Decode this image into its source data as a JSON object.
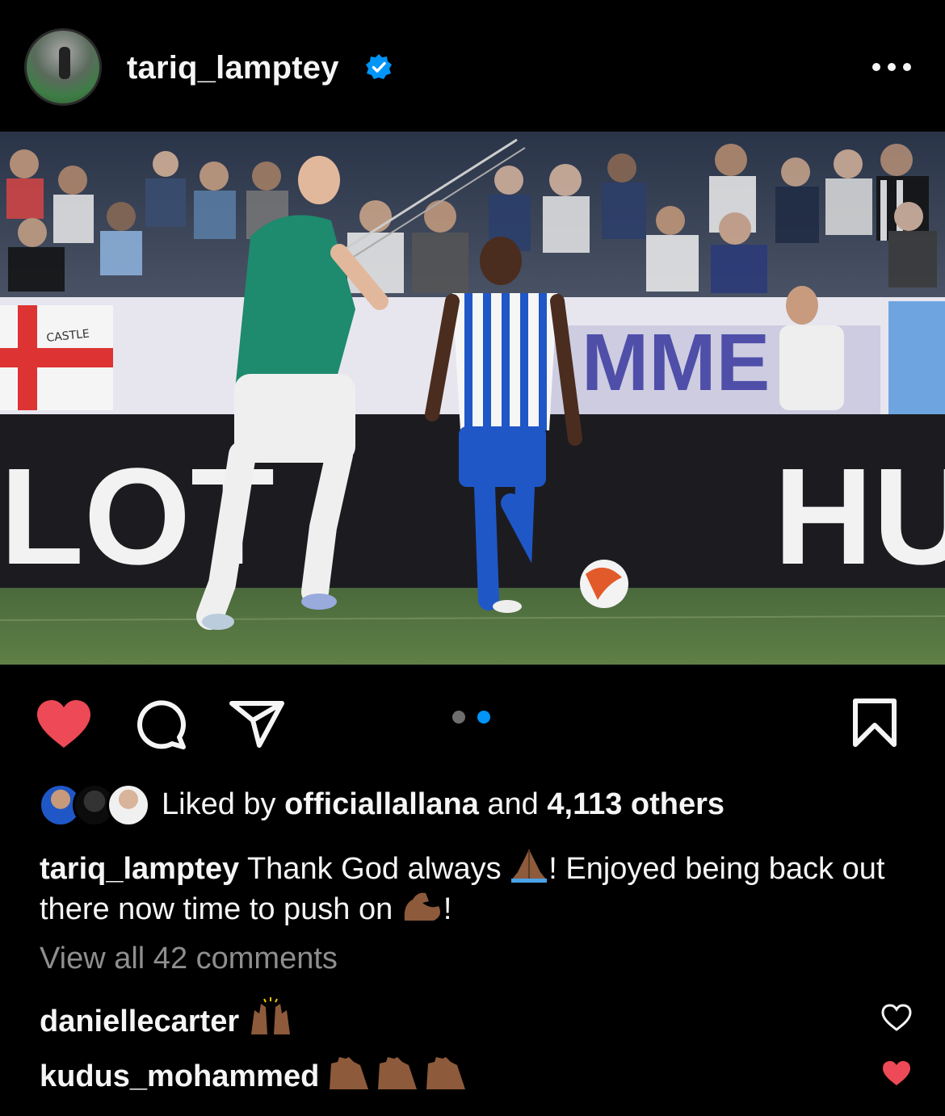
{
  "post": {
    "username": "tariq_lamptey",
    "verified_icon": "verified-badge-icon",
    "more_icon": "more-options-icon"
  },
  "actions": {
    "like_icon": "heart-filled-icon",
    "comment_icon": "comment-icon",
    "share_icon": "share-icon",
    "save_icon": "bookmark-icon",
    "carousel_total": 2,
    "carousel_active": 2
  },
  "likes": {
    "prefix": "Liked by ",
    "user": "officiallallana",
    "middle": " and ",
    "count": "4,113 others"
  },
  "caption": {
    "username": "tariq_lamptey",
    "text_part1": " Thank God always ",
    "text_part2": "! Enjoyed being back out there now time to push on ",
    "text_part3": "!"
  },
  "view_all": "View all 42 comments",
  "comments": [
    {
      "username": "daniellecarter",
      "liked": false
    },
    {
      "username": "kudus_mohammed",
      "liked": true
    }
  ],
  "colors": {
    "background": "#000000",
    "like_red": "#ed4956",
    "verified_blue": "#0095f6",
    "muted_text": "#8e8e8e"
  }
}
